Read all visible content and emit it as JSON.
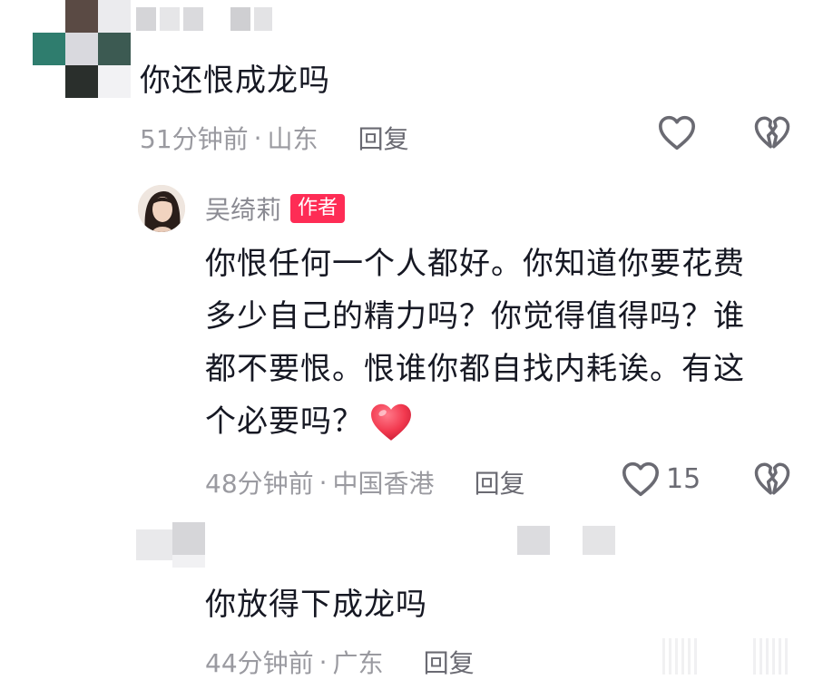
{
  "comments": [
    {
      "text": "你还恨成龙吗",
      "time": "51分钟前",
      "location": "山东",
      "reply_label": "回复"
    },
    {
      "author": "吴绮莉",
      "badge": "作者",
      "text_lines": [
        "你恨任何一个人都好。你知道你要花费",
        "多少自己的精力吗？你觉得值得吗？谁",
        "都不要恨。恨谁你都自找内耗诶。有这",
        "个必要吗？"
      ],
      "time": "48分钟前",
      "location": "中国香港",
      "reply_label": "回复",
      "like_count": "15"
    },
    {
      "text": "你放得下成龙吗",
      "time": "44分钟前",
      "location": "广东",
      "reply_label": "回复"
    }
  ],
  "icons": {
    "like": "heart-outline-icon",
    "dislike": "broken-heart-icon",
    "emoji": "red-heart-emoji"
  },
  "colors": {
    "badge": "#fe2c55",
    "emoji_heart": "#f2394f"
  },
  "separator": "·"
}
